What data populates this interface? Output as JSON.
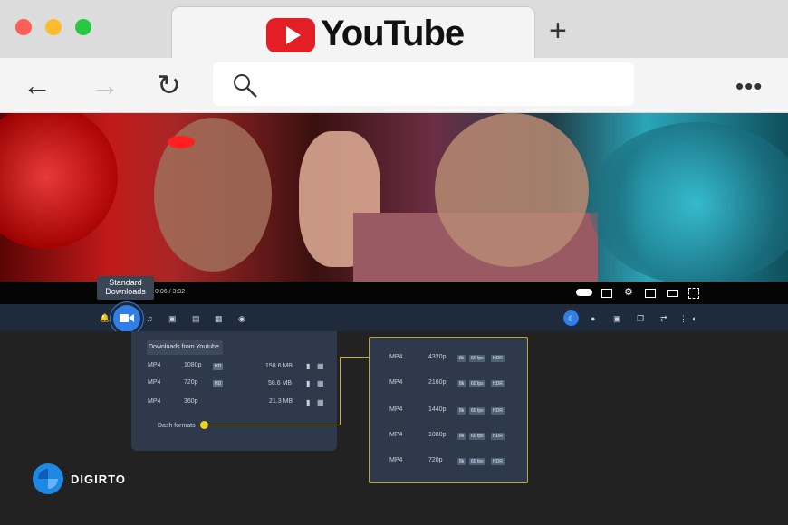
{
  "browser": {
    "tab_title": "YouTube",
    "new_tab_symbol": "+",
    "back_symbol": "←",
    "forward_symbol": "→",
    "reload_symbol": "↻",
    "more_symbol": "•••",
    "search_icon": "search-icon"
  },
  "player": {
    "time": "0:06 / 3:32",
    "tooltip": "Standard Downloads"
  },
  "downloads": {
    "title": "Downloads from Youtube",
    "rows": [
      {
        "format": "MP4",
        "quality": "1080p",
        "badge": "HD",
        "size": "158.6 MB"
      },
      {
        "format": "MP4",
        "quality": "720p",
        "badge": "HD",
        "size": "58.6 MB"
      },
      {
        "format": "MP4",
        "quality": "360p",
        "badge": "",
        "size": "21.3 MB"
      }
    ],
    "dash_label": "Dash formats"
  },
  "dash": {
    "rows": [
      {
        "format": "MP4",
        "quality": "4320p",
        "tags": [
          "8k",
          "60 fps",
          "HDR"
        ]
      },
      {
        "format": "MP4",
        "quality": "2160p",
        "tags": [
          "8k",
          "60 fps",
          "HDR"
        ]
      },
      {
        "format": "MP4",
        "quality": "1440p",
        "tags": [
          "8k",
          "60 fps",
          "HDR"
        ]
      },
      {
        "format": "MP4",
        "quality": "1080p",
        "tags": [
          "8k",
          "60 fps",
          "HDR"
        ]
      },
      {
        "format": "MP4",
        "quality": "720p",
        "tags": [
          "8k",
          "60 fps",
          "HDR"
        ]
      }
    ]
  },
  "brand": {
    "logo_text": "DIGIRTO"
  },
  "colors": {
    "youtube_red": "#e31e24",
    "accent_blue": "#2f7fe6",
    "connector_yellow": "#f2d21b",
    "panel_bg": "#2e3a4b"
  }
}
